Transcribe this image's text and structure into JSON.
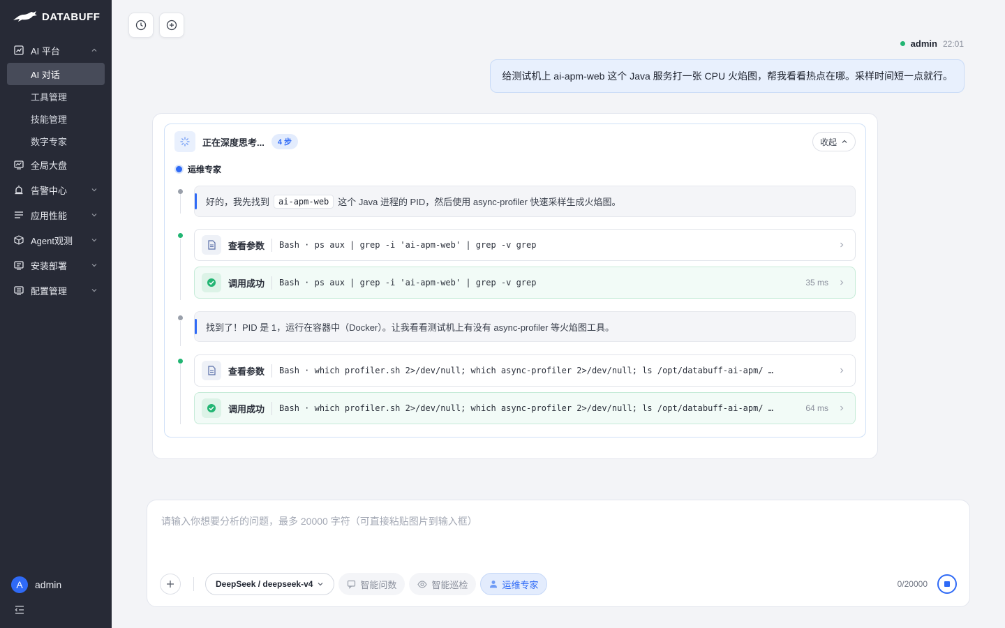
{
  "app": {
    "name": "DATABUFF"
  },
  "sidebar": {
    "groups": [
      {
        "label": "AI 平台",
        "expanded": true,
        "icon": "chart-icon",
        "items": [
          {
            "label": "AI 对话",
            "active": true
          },
          {
            "label": "工具管理"
          },
          {
            "label": "技能管理"
          },
          {
            "label": "数字专家"
          }
        ]
      },
      {
        "label": "全局大盘",
        "icon": "dashboard-icon"
      },
      {
        "label": "告警中心",
        "icon": "alarm-icon"
      },
      {
        "label": "应用性能",
        "icon": "list-icon"
      },
      {
        "label": "Agent观测",
        "icon": "cube-icon"
      },
      {
        "label": "安装部署",
        "icon": "install-icon"
      },
      {
        "label": "配置管理",
        "icon": "config-icon"
      }
    ],
    "user": {
      "avatar_letter": "A",
      "name": "admin"
    }
  },
  "conversation": {
    "user_message": {
      "user": "admin",
      "time": "22:01",
      "text": "给测试机上 ai-apm-web 这个 Java 服务打一张 CPU 火焰图，帮我看看热点在哪。采样时间短一点就行。"
    },
    "thinking": {
      "title": "正在深度思考...",
      "steps_badge": "4 步",
      "collapse_label": "收起",
      "agent": "运维专家",
      "step1_prefix": "好的，我先找到",
      "step1_code": "ai-apm-web",
      "step1_suffix": "这个 Java 进程的 PID，然后使用 async-profiler 快速采样生成火焰图。",
      "tool1_call": {
        "kind": "查看参数",
        "cmd": "Bash · ps aux | grep -i 'ai-apm-web' | grep -v grep"
      },
      "tool1_result": {
        "kind": "调用成功",
        "cmd": "Bash · ps aux | grep -i 'ai-apm-web' | grep -v grep",
        "duration": "35 ms"
      },
      "step2_text": "找到了！PID 是 1，运行在容器中（Docker）。让我看看测试机上有没有 async-profiler 等火焰图工具。",
      "tool2_call": {
        "kind": "查看参数",
        "cmd": "Bash · which profiler.sh 2>/dev/null; which async-profiler 2>/dev/null; ls /opt/databuff-ai-apm/ …"
      },
      "tool2_result": {
        "kind": "调用成功",
        "cmd": "Bash · which profiler.sh 2>/dev/null; which async-profiler 2>/dev/null; ls /opt/databuff-ai-apm/ …",
        "duration": "64 ms"
      }
    }
  },
  "composer": {
    "placeholder": "请输入你想要分析的问题，最多 20000 字符（可直接粘贴图片到输入框）",
    "model": "DeepSeek / deepseek-v4",
    "modes": [
      "智能问数",
      "智能巡检",
      "运维专家"
    ],
    "active_mode": "运维专家",
    "char_count": "0/20000"
  },
  "colors": {
    "accent": "#2f6af6",
    "success": "#22b573",
    "sidebar_bg": "#272a36"
  }
}
